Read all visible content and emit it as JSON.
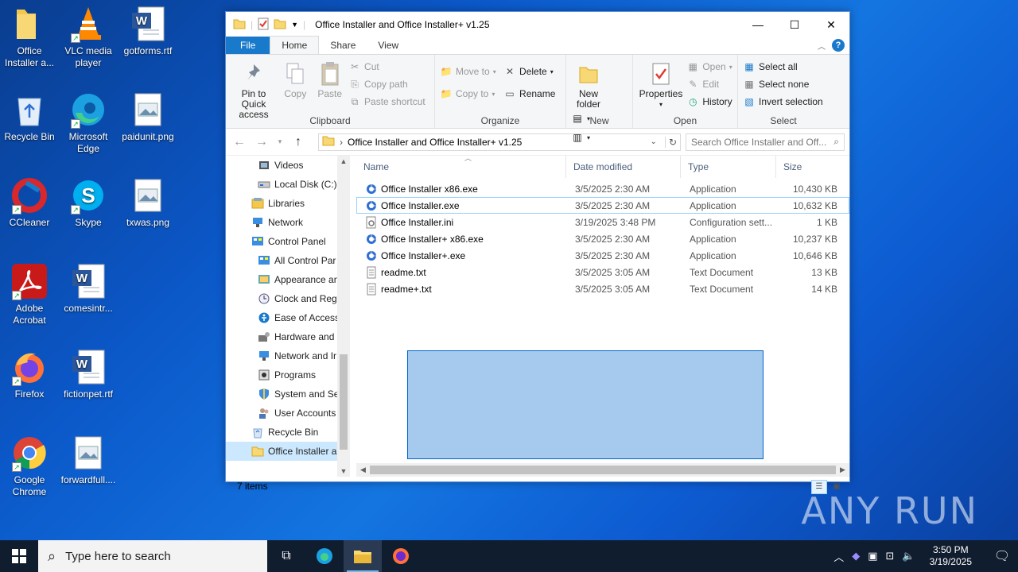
{
  "desktop": {
    "icons": [
      {
        "label": "Office Installer a...",
        "icon": "folder-icon"
      },
      {
        "label": "VLC media player",
        "icon": "vlc-icon"
      },
      {
        "label": "gotforms.rtf",
        "icon": "word-doc-icon"
      },
      {
        "label": "Recycle Bin",
        "icon": "recycle-bin-icon"
      },
      {
        "label": "Microsoft Edge",
        "icon": "edge-icon"
      },
      {
        "label": "paidunit.png",
        "icon": "image-file-icon"
      },
      {
        "label": "CCleaner",
        "icon": "ccleaner-icon"
      },
      {
        "label": "Skype",
        "icon": "skype-icon"
      },
      {
        "label": "txwas.png",
        "icon": "image-file-icon"
      },
      {
        "label": "Adobe Acrobat",
        "icon": "acrobat-icon"
      },
      {
        "label": "comesintr...",
        "icon": "word-doc-icon"
      },
      {
        "label": "Firefox",
        "icon": "firefox-icon"
      },
      {
        "label": "fictionpet.rtf",
        "icon": "word-doc-icon"
      },
      {
        "label": "Google Chrome",
        "icon": "chrome-icon"
      },
      {
        "label": "forwardfull....",
        "icon": "image-file-icon"
      }
    ],
    "watermark": "ANY RUN"
  },
  "window": {
    "title": "Office Installer and Office Installer+ v1.25",
    "tabs": [
      "File",
      "Home",
      "Share",
      "View"
    ],
    "active_tab": "Home",
    "ribbon": {
      "clipboard": {
        "name": "Clipboard",
        "pin": "Pin to Quick access",
        "copy": "Copy",
        "paste": "Paste",
        "cut": "Cut",
        "copy_path": "Copy path",
        "paste_shortcut": "Paste shortcut"
      },
      "organize": {
        "name": "Organize",
        "move_to": "Move to",
        "copy_to": "Copy to",
        "delete": "Delete",
        "rename": "Rename"
      },
      "new": {
        "name": "New",
        "new_folder": "New folder"
      },
      "open": {
        "name": "Open",
        "properties": "Properties",
        "open": "Open",
        "edit": "Edit",
        "history": "History"
      },
      "select": {
        "name": "Select",
        "select_all": "Select all",
        "select_none": "Select none",
        "invert": "Invert selection"
      }
    },
    "address": {
      "path": "Office Installer and Office Installer+ v1.25",
      "search_placeholder": "Search Office Installer and Off..."
    },
    "nav_items": [
      {
        "label": "Videos",
        "icon": "videos-icon",
        "indent": 1
      },
      {
        "label": "Local Disk (C:)",
        "icon": "drive-icon",
        "indent": 1
      },
      {
        "label": "Libraries",
        "icon": "libraries-icon",
        "indent": 0
      },
      {
        "label": "Network",
        "icon": "network-icon",
        "indent": 0
      },
      {
        "label": "Control Panel",
        "icon": "control-panel-icon",
        "indent": 0
      },
      {
        "label": "All Control Par",
        "icon": "control-panel-icon",
        "indent": 1
      },
      {
        "label": "Appearance an",
        "icon": "appearance-icon",
        "indent": 1
      },
      {
        "label": "Clock and Regi",
        "icon": "clock-icon",
        "indent": 1
      },
      {
        "label": "Ease of Access",
        "icon": "ease-access-icon",
        "indent": 1
      },
      {
        "label": "Hardware and",
        "icon": "hardware-icon",
        "indent": 1
      },
      {
        "label": "Network and Ir",
        "icon": "network-icon",
        "indent": 1
      },
      {
        "label": "Programs",
        "icon": "programs-icon",
        "indent": 1
      },
      {
        "label": "System and Sec",
        "icon": "shield-icon",
        "indent": 1
      },
      {
        "label": "User Accounts",
        "icon": "users-icon",
        "indent": 1
      },
      {
        "label": "Recycle Bin",
        "icon": "recycle-bin-icon",
        "indent": 0
      },
      {
        "label": "Office Installer a",
        "icon": "folder-icon",
        "indent": 0,
        "selected": true
      }
    ],
    "columns": {
      "name": "Name",
      "date": "Date modified",
      "type": "Type",
      "size": "Size"
    },
    "files": [
      {
        "name": "Office Installer x86.exe",
        "date": "3/5/2025 2:30 AM",
        "type": "Application",
        "size": "10,430 KB",
        "icon": "exe-icon"
      },
      {
        "name": "Office Installer.exe",
        "date": "3/5/2025 2:30 AM",
        "type": "Application",
        "size": "10,632 KB",
        "icon": "exe-icon",
        "focused": true
      },
      {
        "name": "Office Installer.ini",
        "date": "3/19/2025 3:48 PM",
        "type": "Configuration sett...",
        "size": "1 KB",
        "icon": "ini-icon"
      },
      {
        "name": "Office Installer+ x86.exe",
        "date": "3/5/2025 2:30 AM",
        "type": "Application",
        "size": "10,237 KB",
        "icon": "exe-icon"
      },
      {
        "name": "Office Installer+.exe",
        "date": "3/5/2025 2:30 AM",
        "type": "Application",
        "size": "10,646 KB",
        "icon": "exe-icon"
      },
      {
        "name": "readme.txt",
        "date": "3/5/2025 3:05 AM",
        "type": "Text Document",
        "size": "13 KB",
        "icon": "text-file-icon"
      },
      {
        "name": "readme+.txt",
        "date": "3/5/2025 3:05 AM",
        "type": "Text Document",
        "size": "14 KB",
        "icon": "text-file-icon"
      }
    ],
    "status": "7 items"
  },
  "taskbar": {
    "search_placeholder": "Type here to search",
    "time": "3:50 PM",
    "date": "3/19/2025"
  }
}
